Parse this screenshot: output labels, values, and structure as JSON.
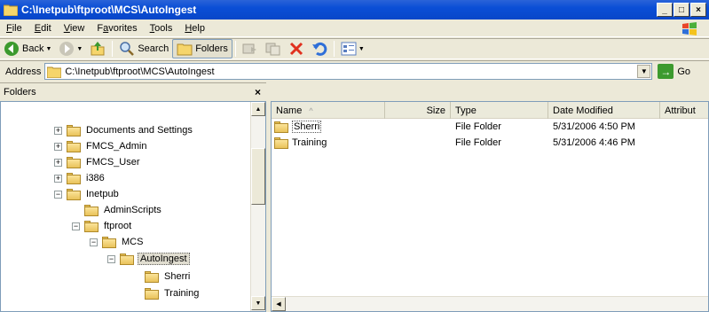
{
  "window": {
    "title": "C:\\Inetpub\\ftproot\\MCS\\AutoIngest",
    "minimize": "_",
    "maximize": "□",
    "close": "×"
  },
  "menu": [
    "File",
    "Edit",
    "View",
    "Favorites",
    "Tools",
    "Help"
  ],
  "menu_mnemonics": [
    "F",
    "E",
    "V",
    "a",
    "T",
    "H"
  ],
  "toolbar": {
    "back": "Back",
    "search": "Search",
    "folders": "Folders"
  },
  "address": {
    "label": "Address",
    "value": "C:\\Inetpub\\ftproot\\MCS\\AutoIngest",
    "go": "Go"
  },
  "folders_pane": {
    "title": "Folders",
    "close": "×",
    "items": [
      {
        "label": "Documents and Settings",
        "expander": "+"
      },
      {
        "label": "FMCS_Admin",
        "expander": "+"
      },
      {
        "label": "FMCS_User",
        "expander": "+"
      },
      {
        "label": "i386",
        "expander": "+"
      },
      {
        "label": "Inetpub",
        "expander": "−"
      },
      {
        "label": "AdminScripts",
        "expander": ""
      },
      {
        "label": "ftproot",
        "expander": "−"
      },
      {
        "label": "MCS",
        "expander": "−"
      },
      {
        "label": "AutoIngest",
        "expander": "−",
        "selected": true
      },
      {
        "label": "Sherri",
        "expander": ""
      },
      {
        "label": "Training",
        "expander": ""
      }
    ]
  },
  "list": {
    "columns": [
      "Name",
      "Size",
      "Type",
      "Date Modified",
      "Attribut"
    ],
    "sort_indicator": "^",
    "rows": [
      {
        "name": "Sherri",
        "size": "",
        "type": "File Folder",
        "modified": "5/31/2006 4:50 PM",
        "attributes": ""
      },
      {
        "name": "Training",
        "size": "",
        "type": "File Folder",
        "modified": "5/31/2006 4:46 PM",
        "attributes": ""
      }
    ]
  },
  "colors": {
    "titlebar": "#0a4ed6",
    "chrome": "#ece9d8",
    "border": "#7f9db9"
  }
}
